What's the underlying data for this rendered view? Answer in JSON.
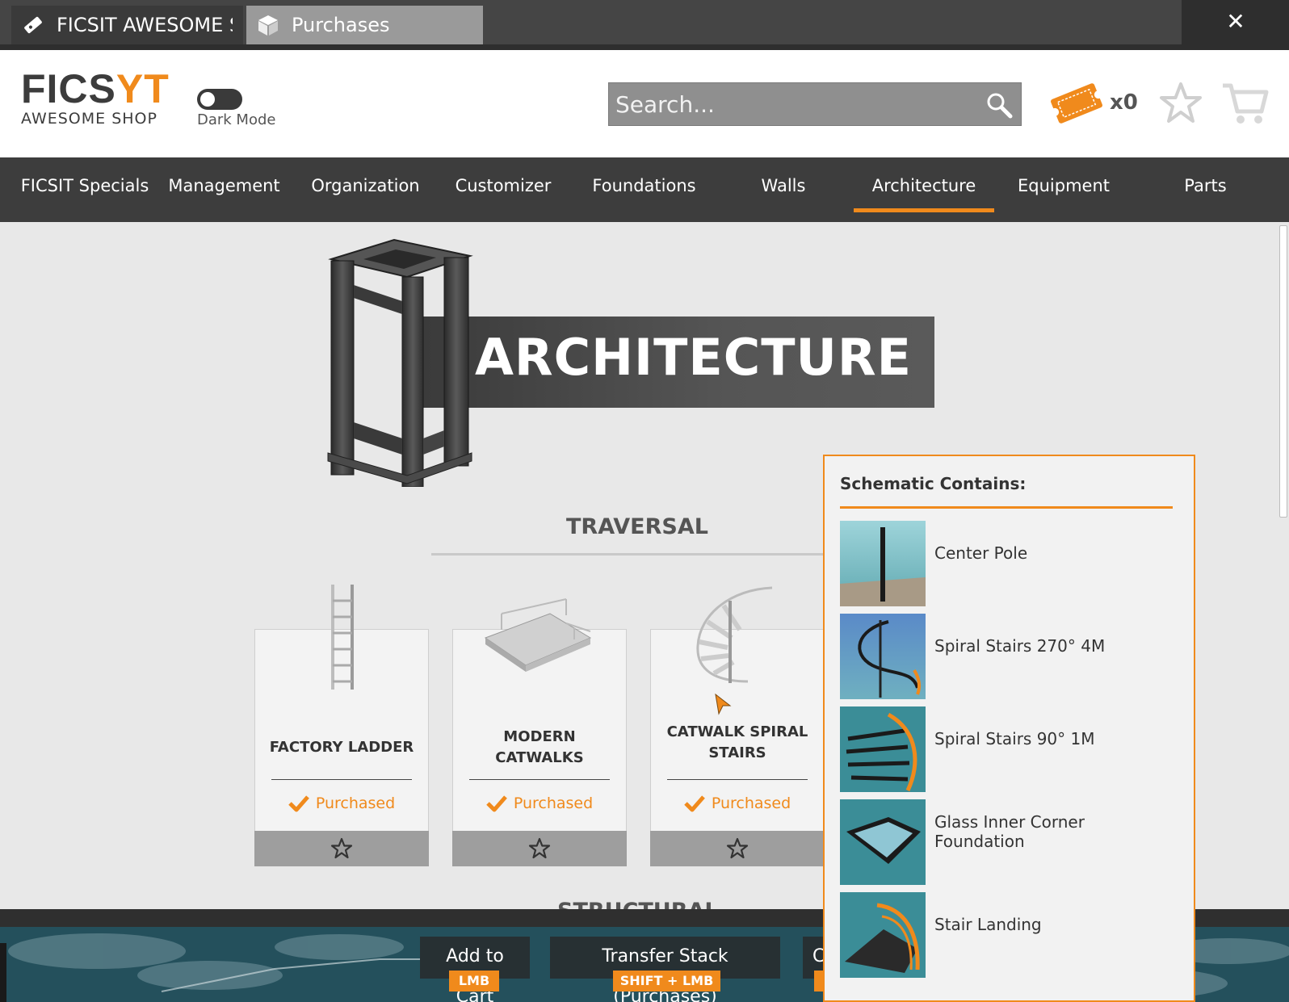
{
  "window": {
    "tabs": [
      {
        "label": "FICSIT AWESOME Shop",
        "icon": "coupon-ticket-icon",
        "active": false
      },
      {
        "label": "Purchases",
        "icon": "box-icon",
        "active": true
      }
    ],
    "close_label": "✕"
  },
  "header": {
    "logo_top_left": "FICS",
    "logo_top_accent": "YT",
    "logo_bottom": "AWESOME SHOP",
    "dark_mode_label": "Dark Mode",
    "dark_mode_on": false,
    "search_placeholder": "Search...",
    "coupon_count": "x0"
  },
  "nav": {
    "items": [
      {
        "label": "FICSIT Specials"
      },
      {
        "label": "Management"
      },
      {
        "label": "Organization"
      },
      {
        "label": "Customizer"
      },
      {
        "label": "Foundations"
      },
      {
        "label": "Walls"
      },
      {
        "label": "Architecture",
        "active": true
      },
      {
        "label": "Equipment"
      },
      {
        "label": "Parts"
      }
    ]
  },
  "main": {
    "banner_title": "ARCHITECTURE",
    "section_title": "TRAVERSAL",
    "next_section_title": "STRUCTURAL",
    "cards": [
      {
        "title": "FACTORY LADDER",
        "status": "Purchased"
      },
      {
        "title": "MODERN CATWALKS",
        "status": "Purchased"
      },
      {
        "title": "CATWALK SPIRAL STAIRS",
        "status": "Purchased"
      }
    ]
  },
  "popup": {
    "title": "Schematic Contains:",
    "items": [
      {
        "label": "Center Pole"
      },
      {
        "label": "Spiral Stairs 270° 4M"
      },
      {
        "label": "Spiral Stairs 90° 1M"
      },
      {
        "label": "Glass Inner Corner Foundation"
      },
      {
        "label": "Stair Landing"
      }
    ]
  },
  "bottom_hints": [
    {
      "action": "Add to Cart",
      "key": "LMB"
    },
    {
      "action": "Transfer Stack (Purchases)",
      "key": "SHIFT + LMB"
    },
    {
      "action": "C",
      "key": ""
    }
  ],
  "colors": {
    "accent": "#f08a1c",
    "nav_bg": "#3d3d3d",
    "content_bg": "#e8e8e8"
  }
}
